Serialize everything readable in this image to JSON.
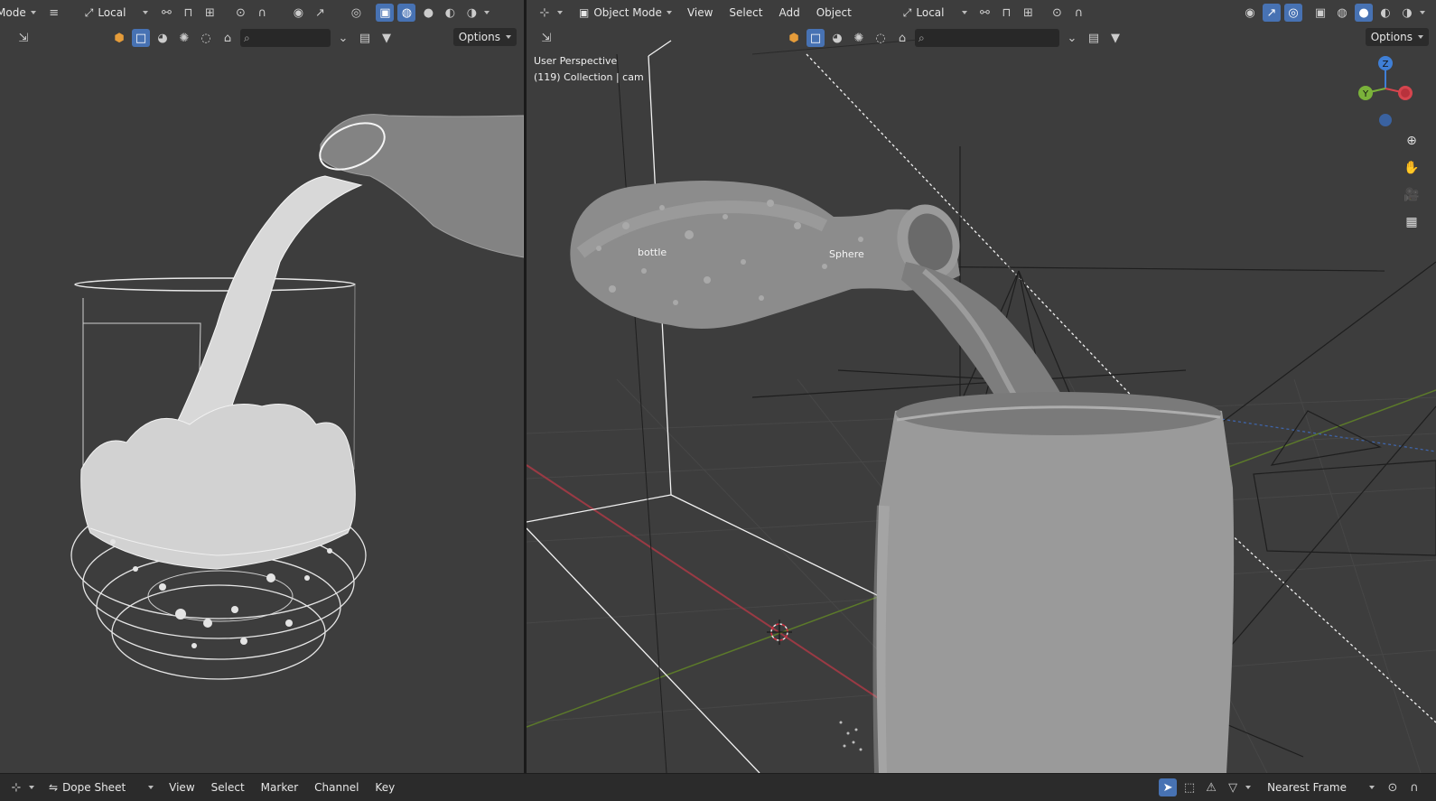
{
  "left_header": {
    "mode_label": "Mode",
    "orientation": "Local",
    "options_label": "Options"
  },
  "right_header": {
    "mode_label": "Object Mode",
    "menus": [
      "View",
      "Select",
      "Add",
      "Object"
    ],
    "orientation": "Local",
    "options_label": "Options"
  },
  "overlay": {
    "view_name": "User Perspective",
    "collection_info": "(119) Collection | cam"
  },
  "objects": {
    "bottle_label": "bottle",
    "sphere_label": "Sphere"
  },
  "gizmo": {
    "z_label": "Z",
    "y_label": "Y",
    "x_color": "#d6454e",
    "y_color": "#7ab23a",
    "z_color": "#3f7fd6"
  },
  "timeline": {
    "editor_type": "Dope Sheet",
    "menus": [
      "View",
      "Select",
      "Marker",
      "Channel",
      "Key"
    ],
    "snap_mode": "Nearest Frame"
  },
  "colors": {
    "viewport_bg": "#3d3d3d",
    "accent": "#4772b3",
    "header_bg": "#303030"
  },
  "icons": {
    "menu": "hamburger-icon",
    "search": "search-icon",
    "filter": "filter-icon",
    "zoom": "zoom-icon",
    "pan": "hand-icon",
    "camera": "camera-icon",
    "grid": "grid-icon"
  }
}
